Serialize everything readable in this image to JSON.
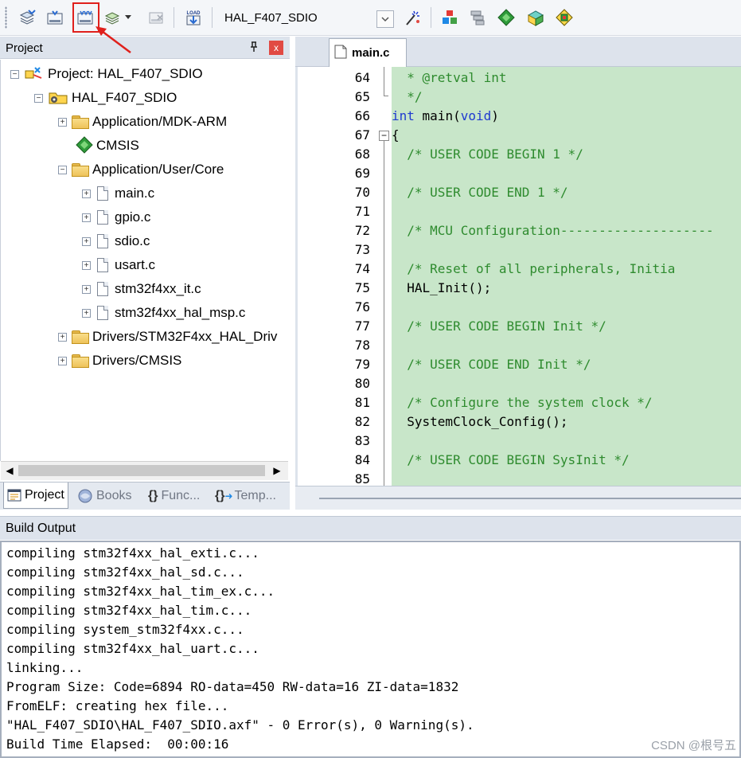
{
  "toolbar": {
    "target_name": "HAL_F407_SDIO",
    "buttons": [
      {
        "icon": "translate-icon"
      },
      {
        "icon": "build-icon"
      },
      {
        "icon": "rebuild-icon",
        "highlighted": true
      },
      {
        "icon": "batch-build-icon"
      },
      {
        "icon": "stop-build-icon"
      },
      {
        "icon": "download-icon",
        "text": "LOAD"
      },
      {
        "icon": "target-options-icon"
      },
      {
        "icon": "manage-project-items-icon"
      },
      {
        "icon": "select-packs-icon"
      },
      {
        "icon": "manage-run-time-environment-icon"
      },
      {
        "icon": "pack-installer-icon"
      },
      {
        "icon": "device-database-icon"
      }
    ]
  },
  "project_panel": {
    "title": "Project",
    "pin_symbol": "ᵖ",
    "close_symbol": "x",
    "tree": [
      {
        "label": "Project: HAL_F407_SDIO",
        "type": "project",
        "expander": "−"
      },
      {
        "label": "HAL_F407_SDIO",
        "type": "target",
        "expander": "−"
      },
      {
        "label": "Application/MDK-ARM",
        "type": "folder",
        "expander": "+"
      },
      {
        "label": "CMSIS",
        "type": "component"
      },
      {
        "label": "Application/User/Core",
        "type": "folder-open",
        "expander": "−"
      },
      {
        "label": "main.c",
        "type": "file",
        "expander": "+"
      },
      {
        "label": "gpio.c",
        "type": "file",
        "expander": "+"
      },
      {
        "label": "sdio.c",
        "type": "file",
        "expander": "+"
      },
      {
        "label": "usart.c",
        "type": "file",
        "expander": "+"
      },
      {
        "label": "stm32f4xx_it.c",
        "type": "file",
        "expander": "+"
      },
      {
        "label": "stm32f4xx_hal_msp.c",
        "type": "file",
        "expander": "+"
      },
      {
        "label": "Drivers/STM32F4xx_HAL_Driv",
        "type": "folder",
        "expander": "+"
      },
      {
        "label": "Drivers/CMSIS",
        "type": "folder",
        "expander": "+"
      }
    ],
    "tabs": [
      {
        "label": "Project",
        "active": true
      },
      {
        "label": "Books",
        "active": false
      },
      {
        "label": "Func...",
        "active": false
      },
      {
        "label": "Temp...",
        "active": false
      }
    ]
  },
  "editor": {
    "tab_label": "main.c",
    "lines": [
      {
        "num": "64",
        "text": "  * @retval int",
        "style": "cmt"
      },
      {
        "num": "65",
        "text": "  */",
        "style": "cmt"
      },
      {
        "num": "66",
        "parts": [
          {
            "t": "int",
            "s": "kw"
          },
          {
            "t": " main(",
            "s": "plain"
          },
          {
            "t": "void",
            "s": "kw"
          },
          {
            "t": ")",
            "s": "plain"
          }
        ]
      },
      {
        "num": "67",
        "text": "{",
        "style": "plain"
      },
      {
        "num": "68",
        "text": "  /* USER CODE BEGIN 1 */",
        "style": "cmt"
      },
      {
        "num": "69",
        "text": "",
        "style": "plain"
      },
      {
        "num": "70",
        "text": "  /* USER CODE END 1 */",
        "style": "cmt"
      },
      {
        "num": "71",
        "text": "",
        "style": "plain"
      },
      {
        "num": "72",
        "text": "  /* MCU Configuration--------------------",
        "style": "cmt"
      },
      {
        "num": "73",
        "text": "",
        "style": "plain"
      },
      {
        "num": "74",
        "text": "  /* Reset of all peripherals, Initia",
        "style": "cmt"
      },
      {
        "num": "75",
        "text": "  HAL_Init();",
        "style": "plain"
      },
      {
        "num": "76",
        "text": "",
        "style": "plain"
      },
      {
        "num": "77",
        "text": "  /* USER CODE BEGIN Init */",
        "style": "cmt"
      },
      {
        "num": "78",
        "text": "",
        "style": "plain"
      },
      {
        "num": "79",
        "text": "  /* USER CODE END Init */",
        "style": "cmt"
      },
      {
        "num": "80",
        "text": "",
        "style": "plain"
      },
      {
        "num": "81",
        "text": "  /* Configure the system clock */",
        "style": "cmt"
      },
      {
        "num": "82",
        "text": "  SystemClock_Config();",
        "style": "plain"
      },
      {
        "num": "83",
        "text": "",
        "style": "plain"
      },
      {
        "num": "84",
        "text": "  /* USER CODE BEGIN SysInit */",
        "style": "cmt"
      },
      {
        "num": "85",
        "text": "",
        "style": "plain"
      }
    ]
  },
  "build_output": {
    "title": "Build Output",
    "lines": [
      "compiling stm32f4xx_hal_exti.c...",
      "compiling stm32f4xx_hal_sd.c...",
      "compiling stm32f4xx_hal_tim_ex.c...",
      "compiling stm32f4xx_hal_tim.c...",
      "compiling system_stm32f4xx.c...",
      "compiling stm32f4xx_hal_uart.c...",
      "linking...",
      "Program Size: Code=6894 RO-data=450 RW-data=16 ZI-data=1832",
      "FromELF: creating hex file...",
      "\"HAL_F407_SDIO\\HAL_F407_SDIO.axf\" - 0 Error(s), 0 Warning(s).",
      "Build Time Elapsed:  00:00:16"
    ]
  },
  "watermark": "CSDN @根号五",
  "colors": {
    "highlight": "#e0201c",
    "code_background": "#c8e6c9",
    "comment": "#2e8b2e",
    "keyword": "#1f3ad0"
  }
}
